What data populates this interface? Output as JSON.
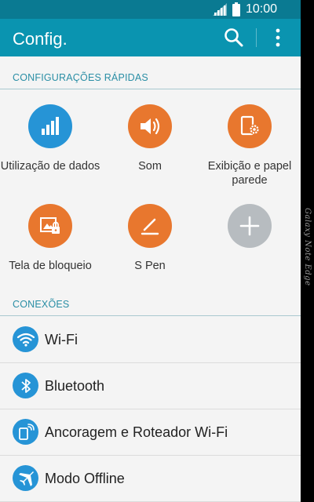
{
  "status_bar": {
    "time": "10:00"
  },
  "app_bar": {
    "title": "Config."
  },
  "quick_settings": {
    "header": "CONFIGURAÇÕES RÁPIDAS",
    "tiles": [
      {
        "label": "Utilização de dados",
        "icon": "data-usage-icon",
        "color": "#2694d6"
      },
      {
        "label": "Som",
        "icon": "speaker-icon",
        "color": "#e8772e"
      },
      {
        "label": "Exibição e papel parede",
        "icon": "display-settings-icon",
        "color": "#e8772e"
      },
      {
        "label": "Tela de bloqueio",
        "icon": "lock-screen-icon",
        "color": "#e8772e"
      },
      {
        "label": "S Pen",
        "icon": "pen-icon",
        "color": "#e8772e"
      },
      {
        "label": "",
        "icon": "plus-icon",
        "color": "#b7bcc0"
      }
    ]
  },
  "connections": {
    "header": "CONEXÕES",
    "items": [
      {
        "label": "Wi-Fi",
        "icon": "wifi-icon"
      },
      {
        "label": "Bluetooth",
        "icon": "bluetooth-icon"
      },
      {
        "label": "Ancoragem e Roteador Wi-Fi",
        "icon": "tethering-icon"
      },
      {
        "label": "Modo Offline",
        "icon": "airplane-icon"
      }
    ]
  },
  "device_edge": {
    "text": "Galaxy Note Edge"
  },
  "colors": {
    "status_bar": "#0a7a92",
    "app_bar": "#0a94b0",
    "accent": "#2a8ea5",
    "blue_icon": "#2694d6",
    "orange_icon": "#e8772e",
    "grey_icon": "#b7bcc0"
  }
}
